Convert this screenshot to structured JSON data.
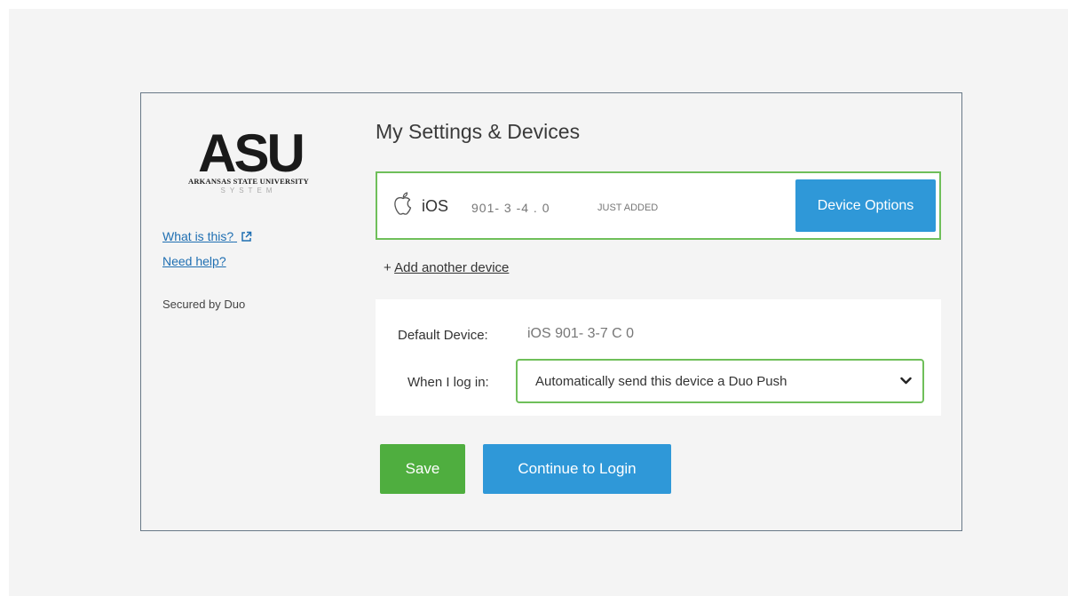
{
  "brand": {
    "logo_letters": "ASU",
    "logo_line1": "ARKANSAS STATE UNIVERSITY",
    "logo_line2": "SYSTEM"
  },
  "sidebar": {
    "what_is_this": "What is this?",
    "need_help": "Need help?",
    "secured_by": "Secured by Duo"
  },
  "main": {
    "title": "My Settings & Devices",
    "device": {
      "os": "iOS",
      "number": "901- 3 -4 . 0",
      "badge": "JUST ADDED",
      "options_button": "Device Options"
    },
    "add_device_prefix": "+",
    "add_device_link": "Add another device",
    "default_device_label": "Default Device:",
    "default_device_value": "iOS 901- 3-7 C 0",
    "when_login_label": "When I log in:",
    "when_login_value": "Automatically send this device a Duo Push",
    "save_button": "Save",
    "continue_button": "Continue to Login"
  },
  "colors": {
    "primary_blue": "#2f98d8",
    "save_green": "#4fae3f",
    "highlight_border_green": "#6fbf5a",
    "link_blue": "#1f6fb2"
  },
  "icons": {
    "device_icon": "apple-icon",
    "external_link": "external-link-icon",
    "select_arrow": "chevron-down-icon"
  }
}
